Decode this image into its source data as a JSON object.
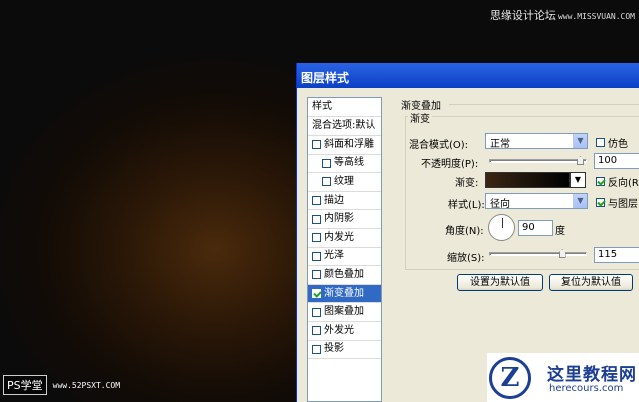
{
  "watermark": {
    "text": "思缘设计论坛",
    "url": "www.MISSVUAN.COM"
  },
  "ps_logo": {
    "label": "PS学堂",
    "site": "www.52PSXT.COM"
  },
  "dialog": {
    "title": "图层样式",
    "style_list": {
      "header": "样式",
      "blend_default": "混合选项:默认",
      "items": [
        {
          "label": "斜面和浮雕",
          "checked": false,
          "sub": false
        },
        {
          "label": "等高线",
          "checked": false,
          "sub": true
        },
        {
          "label": "纹理",
          "checked": false,
          "sub": true
        },
        {
          "label": "描边",
          "checked": false,
          "sub": false
        },
        {
          "label": "内阴影",
          "checked": false,
          "sub": false
        },
        {
          "label": "内发光",
          "checked": false,
          "sub": false
        },
        {
          "label": "光泽",
          "checked": false,
          "sub": false
        },
        {
          "label": "颜色叠加",
          "checked": false,
          "sub": false
        },
        {
          "label": "渐变叠加",
          "checked": true,
          "sub": false
        },
        {
          "label": "图案叠加",
          "checked": false,
          "sub": false
        },
        {
          "label": "外发光",
          "checked": false,
          "sub": false
        },
        {
          "label": "投影",
          "checked": false,
          "sub": false
        }
      ],
      "selected": "渐变叠加"
    },
    "panel": {
      "group_title": "渐变叠加",
      "subgroup_title": "渐变",
      "blend_mode_label": "混合模式(O):",
      "blend_mode_value": "正常",
      "dither_label": "仿色",
      "dither_checked": false,
      "opacity_label": "不透明度(P):",
      "opacity_value": "100",
      "gradient_label": "渐变:",
      "reverse_label": "反向(R)",
      "reverse_checked": true,
      "style_label": "样式(L):",
      "style_value": "径向",
      "align_label": "与图层",
      "align_checked": true,
      "angle_label": "角度(N):",
      "angle_value": "90",
      "angle_unit": "度",
      "scale_label": "缩放(S):",
      "scale_value": "115",
      "set_default_button": "设置为默认值",
      "reset_default_button": "复位为默认值"
    }
  },
  "brand": {
    "name": "这里教程网",
    "url": "herecours.com"
  },
  "colors": {
    "titlebar": "#0a40c4",
    "selected": "#316ac5",
    "dialog_bg": "#ece9d8"
  }
}
